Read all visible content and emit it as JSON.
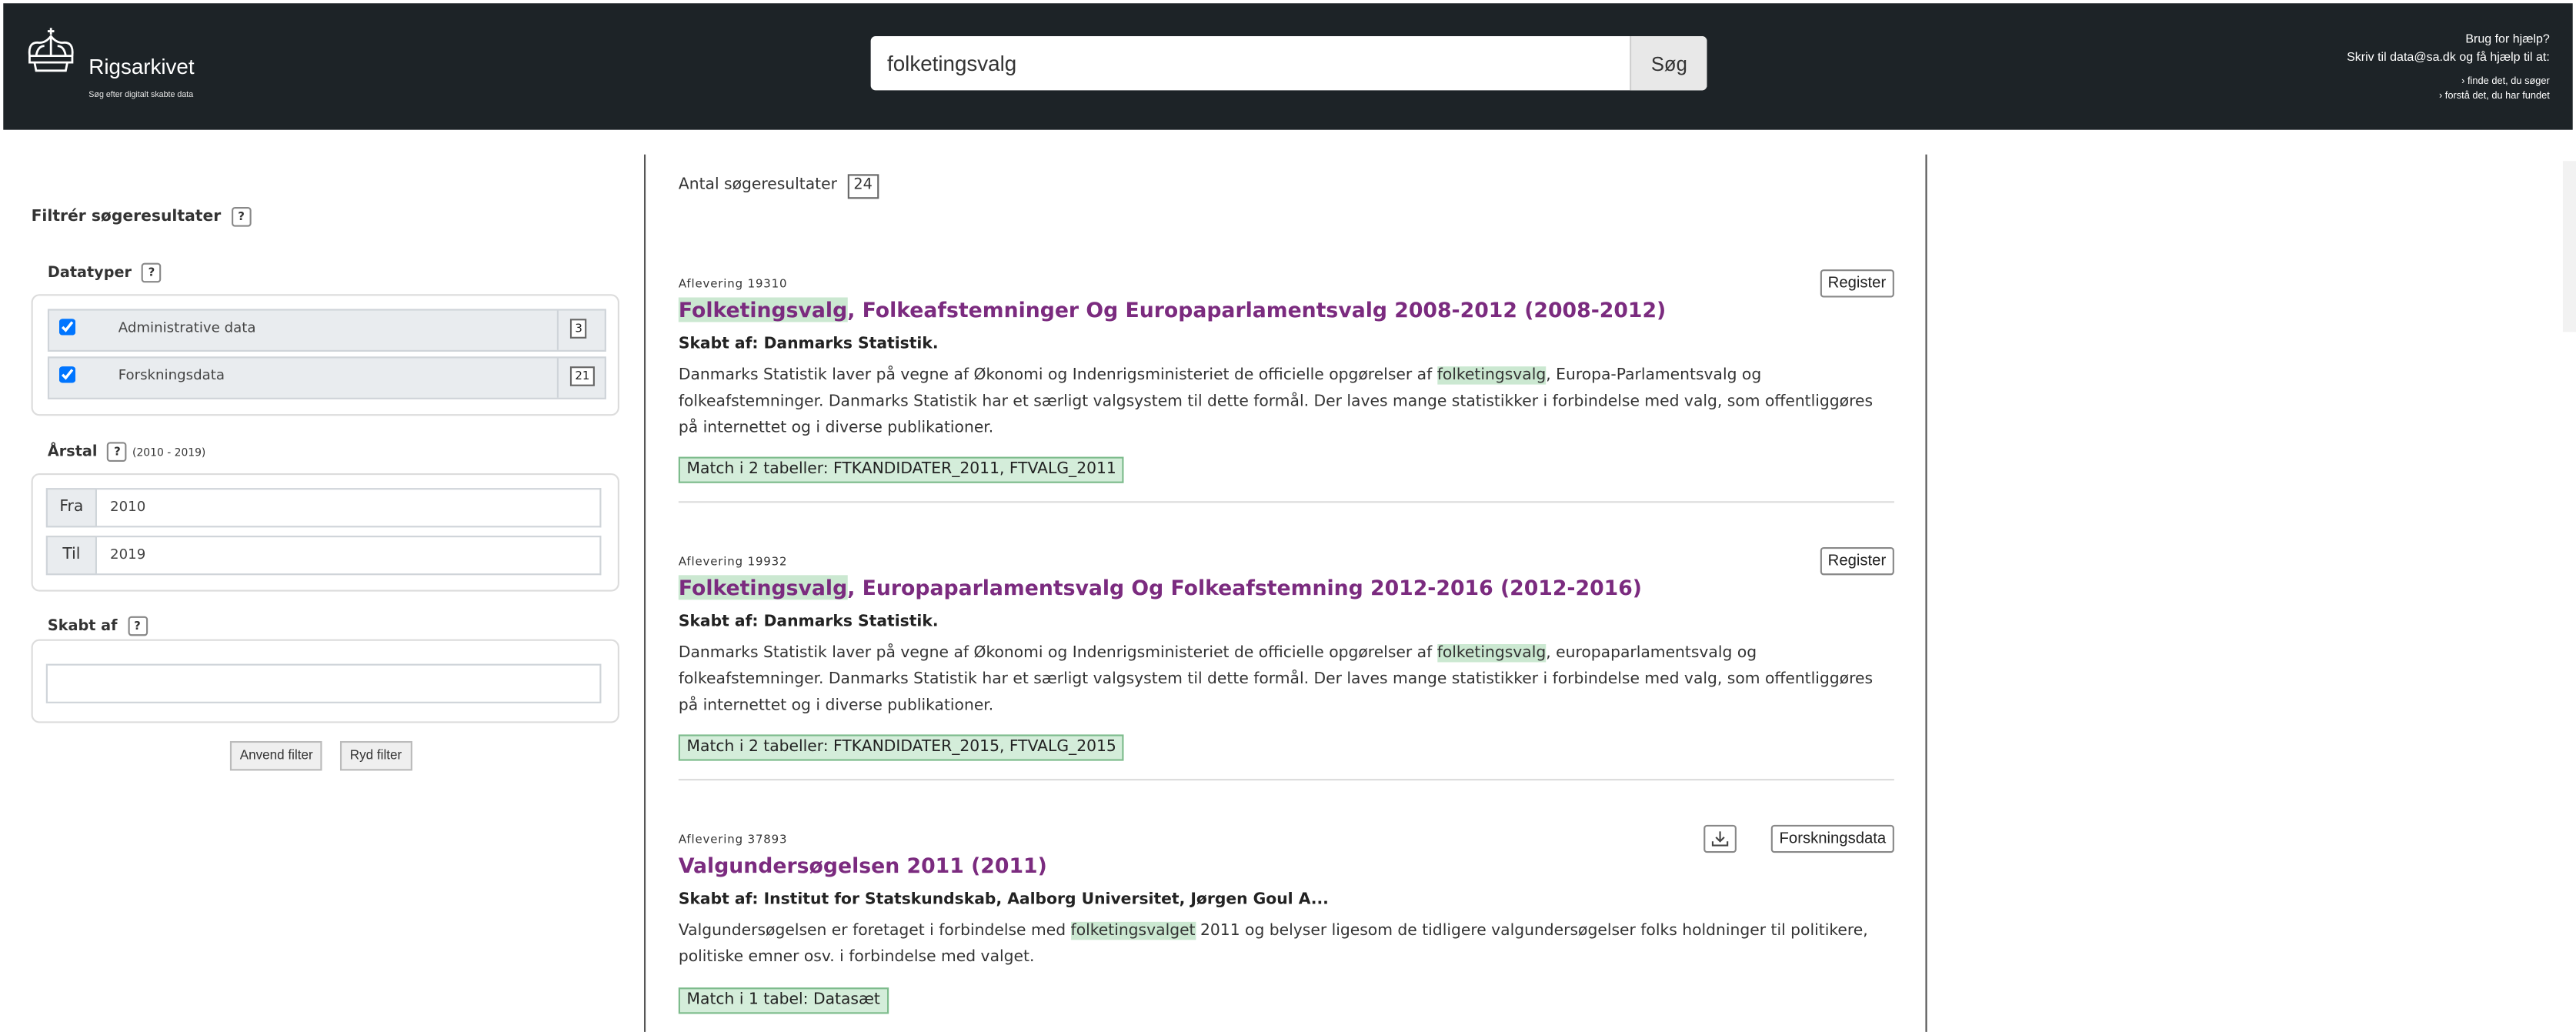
{
  "header": {
    "logo_name": "Rigsarkivet",
    "logo_tagline": "Søg efter digitalt skabte data",
    "search_value": "folketingsvalg",
    "search_button": "Søg",
    "help_title": "Brug for hjælp?",
    "help_line_prefix": "Skriv til",
    "help_email": "data@sa.dk",
    "help_line_suffix": "og få hjælp til at:",
    "help_link_1": "› finde det, du søger",
    "help_link_2": "› forstå det, du har fundet"
  },
  "sidebar": {
    "heading": "Filtrér søgeresultater",
    "help_mark": "?",
    "datatypes_label": "Datatyper",
    "datatypes": [
      {
        "label": "Administrative data",
        "count": "3",
        "checked": true
      },
      {
        "label": "Forskningsdata",
        "count": "21",
        "checked": true
      }
    ],
    "year_label": "Årstal",
    "year_range": "(2010 - 2019)",
    "from_label": "Fra",
    "from_value": "2010",
    "to_label": "Til",
    "to_value": "2019",
    "creator_label": "Skabt af",
    "apply_button": "Anvend filter",
    "clear_button": "Ryd filter"
  },
  "results": {
    "count_label": "Antal søgeresultater",
    "count": "24",
    "items": [
      {
        "id": "Aflevering 19310",
        "title_highlight": "Folketingsvalg",
        "title_rest": ", Folkeafstemninger Og Europaparlamentsvalg 2008-2012 (2008-2012)",
        "creator": "Skabt af: Danmarks Statistik.",
        "desc_before": "Danmarks Statistik laver på vegne af Økonomi og Indenrigsministeriet de officielle opgørelser af ",
        "desc_highlight": "folketingsvalg",
        "desc_after": ", Europa-Parlamentsvalg og folkeafstemninger. Danmarks Statistik har et særligt valgsystem til dette formål. Der laves mange statistikker i forbindelse med valg, som offentliggøres på internettet og i diverse publikationer.",
        "match": "Match i 2 tabeller: FTKANDIDATER_2011, FTVALG_2011",
        "button": "Register"
      },
      {
        "id": "Aflevering 19932",
        "title_highlight": "Folketingsvalg",
        "title_rest": ", Europaparlamentsvalg Og Folkeafstemning 2012-2016 (2012-2016)",
        "creator": "Skabt af: Danmarks Statistik.",
        "desc_before": "Danmarks Statistik laver på vegne af Økonomi og Indenrigsministeriet de officielle opgørelser af ",
        "desc_highlight": "folketingsvalg",
        "desc_after": ", europaparlamentsvalg og folkeafstemninger. Danmarks Statistik har et særligt valgsystem til dette formål. Der laves mange statistikker i forbindelse med valg, som offentliggøres på internettet og i diverse publikationer.",
        "match": "Match i 2 tabeller: FTKANDIDATER_2015, FTVALG_2015",
        "button": "Register"
      },
      {
        "id": "Aflevering 37893",
        "title_highlight": "",
        "title_rest": "Valgundersøgelsen 2011 (2011)",
        "creator": "Skabt af: Institut for Statskundskab, Aalborg Universitet, Jørgen Goul A...",
        "desc_before": "Valgundersøgelsen er foretaget i forbindelse med ",
        "desc_highlight": "folketingsvalget",
        "desc_after": " 2011 og belyser ligesom de tidligere valgundersøgelser folks holdninger til politikere, politiske emner osv. i forbindelse med valget.",
        "match": "Match i 1 tabel: Datasæt",
        "button": "Forskningsdata",
        "download_icon": "download-icon"
      }
    ]
  }
}
